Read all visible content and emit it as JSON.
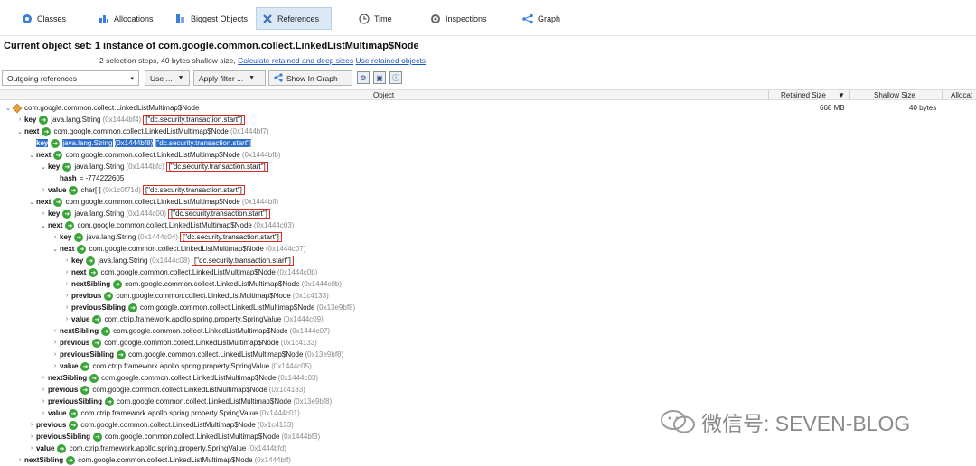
{
  "tabs": [
    {
      "label": "Classes",
      "icon": "classes-icon",
      "active": false
    },
    {
      "label": "Allocations",
      "icon": "allocations-icon",
      "active": false
    },
    {
      "label": "Biggest Objects",
      "icon": "biggest-objects-icon",
      "active": false
    },
    {
      "label": "References",
      "icon": "references-icon",
      "active": true
    },
    {
      "label": "Time",
      "icon": "time-icon",
      "active": false
    },
    {
      "label": "Inspections",
      "icon": "inspections-icon",
      "active": false
    },
    {
      "label": "Graph",
      "icon": "graph-icon",
      "active": false
    }
  ],
  "header": {
    "title": "Current object set:  1 instance of com.google.common.collect.LinkedListMultimap$Node",
    "subtitle": "2 selection steps, 40 bytes shallow size,",
    "link1": "Calculate retained and deep sizes",
    "link2": "Use retained objects"
  },
  "toolbar": {
    "mode_select": "Outgoing references",
    "use_button": "Use ...",
    "apply_filter_button": "Apply filter ...",
    "show_in_graph_button": "Show In Graph"
  },
  "columns": {
    "object": "Object",
    "retained_size": "Retained Size",
    "shallow_size": "Shallow Size",
    "allocation": "Allocat"
  },
  "root": {
    "class": "com.google.common.collect.LinkedListMultimap$Node",
    "retained_size": "668 MB",
    "shallow_size": "40 bytes"
  },
  "tree_rows": [
    {
      "label": "key",
      "cls": "java.lang.String",
      "addr": "(0x1444bf4)",
      "val": "[\"dc.security.transaction.start\"]",
      "hl": true,
      "selected": false
    },
    {
      "label": "next",
      "cls": "com.google.common.collect.LinkedListMultimap$Node",
      "addr": "(0x1444bf7)",
      "val": "",
      "hl": false,
      "selected": false
    },
    {
      "label": "key",
      "cls": "java.lang.String",
      "addr": "(0x1444bf8)",
      "val": "[\"dc.security.transaction.start\"]",
      "hl": false,
      "selected": true
    },
    {
      "label": "next",
      "cls": "com.google.common.collect.LinkedListMultimap$Node",
      "addr": "(0x1444bfb)",
      "val": "",
      "hl": false,
      "selected": false
    },
    {
      "label": "key",
      "cls": "java.lang.String",
      "addr": "(0x1444bfc)",
      "val": "[\"dc.security.transaction.start\"]",
      "hl": true,
      "selected": false
    },
    {
      "label": "hash",
      "cls": "= -774222605",
      "addr": "",
      "val": "",
      "hl": false,
      "selected": false
    },
    {
      "label": "value",
      "cls": "char[ ]",
      "addr": "(0x1c0f71d)",
      "val": "[\"dc.security.transaction.start\"]",
      "hl": true,
      "selected": false
    },
    {
      "label": "next",
      "cls": "com.google.common.collect.LinkedListMultimap$Node",
      "addr": "(0x1444bff)",
      "val": "",
      "hl": false,
      "selected": false
    },
    {
      "label": "key",
      "cls": "java.lang.String",
      "addr": "(0x1444c00)",
      "val": "[\"dc.security.transaction.start\"]",
      "hl": true,
      "selected": false
    },
    {
      "label": "next",
      "cls": "com.google.common.collect.LinkedListMultimap$Node",
      "addr": "(0x1444c03)",
      "val": "",
      "hl": false,
      "selected": false
    },
    {
      "label": "key",
      "cls": "java.lang.String",
      "addr": "(0x1444c04)",
      "val": "[\"dc.security.transaction.start\"]",
      "hl": true,
      "selected": false
    },
    {
      "label": "next",
      "cls": "com.google.common.collect.LinkedListMultimap$Node",
      "addr": "(0x1444c07)",
      "val": "",
      "hl": false,
      "selected": false
    },
    {
      "label": "key",
      "cls": "java.lang.String",
      "addr": "(0x1444c08)",
      "val": "[\"dc.security.transaction.start\"]",
      "hl": true,
      "selected": false
    },
    {
      "label": "next",
      "cls": "com.google.common.collect.LinkedListMultimap$Node",
      "addr": "(0x1444c0b)",
      "val": "",
      "hl": false,
      "selected": false
    },
    {
      "label": "nextSibling",
      "cls": "com.google.common.collect.LinkedListMultimap$Node",
      "addr": "(0x1444c0b)",
      "val": "",
      "hl": false,
      "selected": false
    },
    {
      "label": "previous",
      "cls": "com.google.common.collect.LinkedListMultimap$Node",
      "addr": "(0x1c4133)",
      "val": "",
      "hl": false,
      "selected": false
    },
    {
      "label": "previousSibling",
      "cls": "com.google.common.collect.LinkedListMultimap$Node",
      "addr": "(0x13e9bf8)",
      "val": "",
      "hl": false,
      "selected": false
    },
    {
      "label": "value",
      "cls": "com.ctrip.framework.apollo.spring.property.SpringValue",
      "addr": "(0x1444c09)",
      "val": "",
      "hl": false,
      "selected": false
    },
    {
      "label": "nextSibling",
      "cls": "com.google.common.collect.LinkedListMultimap$Node",
      "addr": "(0x1444c07)",
      "val": "",
      "hl": false,
      "selected": false
    },
    {
      "label": "previous",
      "cls": "com.google.common.collect.LinkedListMultimap$Node",
      "addr": "(0x1c4133)",
      "val": "",
      "hl": false,
      "selected": false
    },
    {
      "label": "previousSibling",
      "cls": "com.google.common.collect.LinkedListMultimap$Node",
      "addr": "(0x13e9bf8)",
      "val": "",
      "hl": false,
      "selected": false
    },
    {
      "label": "value",
      "cls": "com.ctrip.framework.apollo.spring.property.SpringValue",
      "addr": "(0x1444c05)",
      "val": "",
      "hl": false,
      "selected": false
    },
    {
      "label": "nextSibling",
      "cls": "com.google.common.collect.LinkedListMultimap$Node",
      "addr": "(0x1444c03)",
      "val": "",
      "hl": false,
      "selected": false
    },
    {
      "label": "previous",
      "cls": "com.google.common.collect.LinkedListMultimap$Node",
      "addr": "(0x1c4133)",
      "val": "",
      "hl": false,
      "selected": false
    },
    {
      "label": "previousSibling",
      "cls": "com.google.common.collect.LinkedListMultimap$Node",
      "addr": "(0x13e9bf8)",
      "val": "",
      "hl": false,
      "selected": false
    },
    {
      "label": "value",
      "cls": "com.ctrip.framework.apollo.spring.property.SpringValue",
      "addr": "(0x1444c01)",
      "val": "",
      "hl": false,
      "selected": false
    },
    {
      "label": "previous",
      "cls": "com.google.common.collect.LinkedListMultimap$Node",
      "addr": "(0x1c4133)",
      "val": "",
      "hl": false,
      "selected": false
    },
    {
      "label": "previousSibling",
      "cls": "com.google.common.collect.LinkedListMultimap$Node",
      "addr": "(0x1444bf3)",
      "val": "",
      "hl": false,
      "selected": false
    },
    {
      "label": "value",
      "cls": "com.ctrip.framework.apollo.spring.property.SpringValue",
      "addr": "(0x1444bfd)",
      "val": "",
      "hl": false,
      "selected": false
    },
    {
      "label": "nextSibling",
      "cls": "com.google.common.collect.LinkedListMultimap$Node",
      "addr": "(0x1444bff)",
      "val": "",
      "hl": false,
      "selected": false
    },
    {
      "label": "previous",
      "cls": "com.google.common.collect.LinkedListMultimap$Node",
      "addr": "(0x1c4133)",
      "val": "",
      "hl": false,
      "selected": false
    }
  ],
  "watermark": "微信号: SEVEN-BLOG"
}
